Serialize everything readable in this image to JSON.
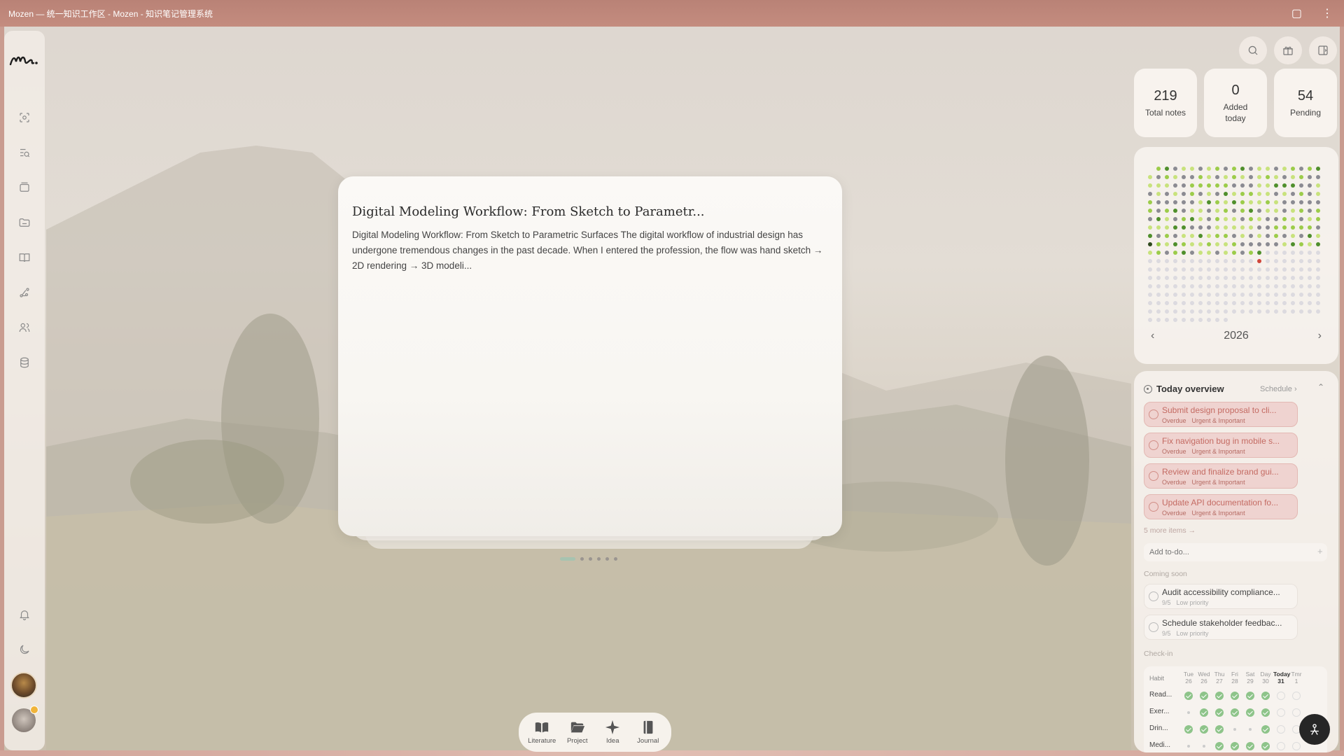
{
  "window": {
    "title": "Mozen — 统一知识工作区 - Mozen - 知识笔记管理系统"
  },
  "sidebar": {
    "items": [
      {
        "name": "capture-icon"
      },
      {
        "name": "inbox-search-icon"
      },
      {
        "name": "cards-icon"
      },
      {
        "name": "folder-icon"
      },
      {
        "name": "book-icon"
      },
      {
        "name": "graph-icon"
      },
      {
        "name": "people-icon"
      },
      {
        "name": "database-icon"
      }
    ],
    "bottom": [
      {
        "name": "bell-icon"
      },
      {
        "name": "moon-icon"
      }
    ]
  },
  "card": {
    "title": "Digital Modeling Workflow: From Sketch to Parametr...",
    "body": "Digital Modeling Workflow: From Sketch to Parametric Surfaces The digital workflow of industrial design has undergone tremendous changes in the past decade. When I entered the profession, the flow was hand sketch → 2D rendering → 3D modeli...",
    "page_count": 6,
    "active_page": 0
  },
  "dock": {
    "items": [
      {
        "label": "Literature",
        "icon": "book-open-icon"
      },
      {
        "label": "Project",
        "icon": "folder-open-icon"
      },
      {
        "label": "Idea",
        "icon": "sparkle-icon"
      },
      {
        "label": "Journal",
        "icon": "journal-icon"
      }
    ]
  },
  "stats": [
    {
      "value": "219",
      "label": "Total notes"
    },
    {
      "value": "0",
      "label": "Added today"
    },
    {
      "value": "54",
      "label": "Pending"
    }
  ],
  "heatmap": {
    "year": "2026",
    "colors": {
      "empty": "#dcdadf",
      "gray": "#8b8b92",
      "low": "#c8e27c",
      "mid": "#9ccc4a",
      "high": "#4f8f2c",
      "dark": "#2f4a1e",
      "red": "#d0453a"
    }
  },
  "overview": {
    "title": "Today overview",
    "schedule_link": "Schedule",
    "urgent_tasks": [
      {
        "title": "Submit design proposal to cli...",
        "status": "Overdue",
        "priority": "Urgent & Important"
      },
      {
        "title": "Fix navigation bug in mobile s...",
        "status": "Overdue",
        "priority": "Urgent & Important"
      },
      {
        "title": "Review and finalize brand gui...",
        "status": "Overdue",
        "priority": "Urgent & Important"
      },
      {
        "title": "Update API documentation fo...",
        "status": "Overdue",
        "priority": "Urgent & Important"
      }
    ],
    "more_items": "5 more items →",
    "add_placeholder": "Add to-do...",
    "coming_soon_label": "Coming soon",
    "coming_soon": [
      {
        "title": "Audit accessibility compliance...",
        "date": "9/5",
        "priority": "Low priority"
      },
      {
        "title": "Schedule stakeholder feedbac...",
        "date": "9/5",
        "priority": "Low priority"
      }
    ],
    "checkin_label": "Check-in",
    "habits": {
      "header": "Habit",
      "days": [
        {
          "d": "Tue",
          "n": "26"
        },
        {
          "d": "Wed",
          "n": "26"
        },
        {
          "d": "Thu",
          "n": "27"
        },
        {
          "d": "Fri",
          "n": "28"
        },
        {
          "d": "Sat",
          "n": "29"
        },
        {
          "d": "Day",
          "n": "30"
        },
        {
          "d": "Today",
          "n": "31"
        },
        {
          "d": "Tmr",
          "n": "1"
        }
      ],
      "rows": [
        {
          "name": "Read...",
          "checks": [
            "done",
            "done",
            "done",
            "done",
            "done",
            "done",
            "empty",
            "empty"
          ]
        },
        {
          "name": "Exer...",
          "checks": [
            "dash",
            "done",
            "done",
            "done",
            "done",
            "done",
            "empty",
            "empty"
          ]
        },
        {
          "name": "Drin...",
          "checks": [
            "done",
            "done",
            "done",
            "dash",
            "dash",
            "done",
            "empty",
            "empty"
          ]
        },
        {
          "name": "Medi...",
          "checks": [
            "dash",
            "dash",
            "done",
            "done",
            "done",
            "done",
            "empty",
            "empty"
          ]
        }
      ]
    }
  }
}
